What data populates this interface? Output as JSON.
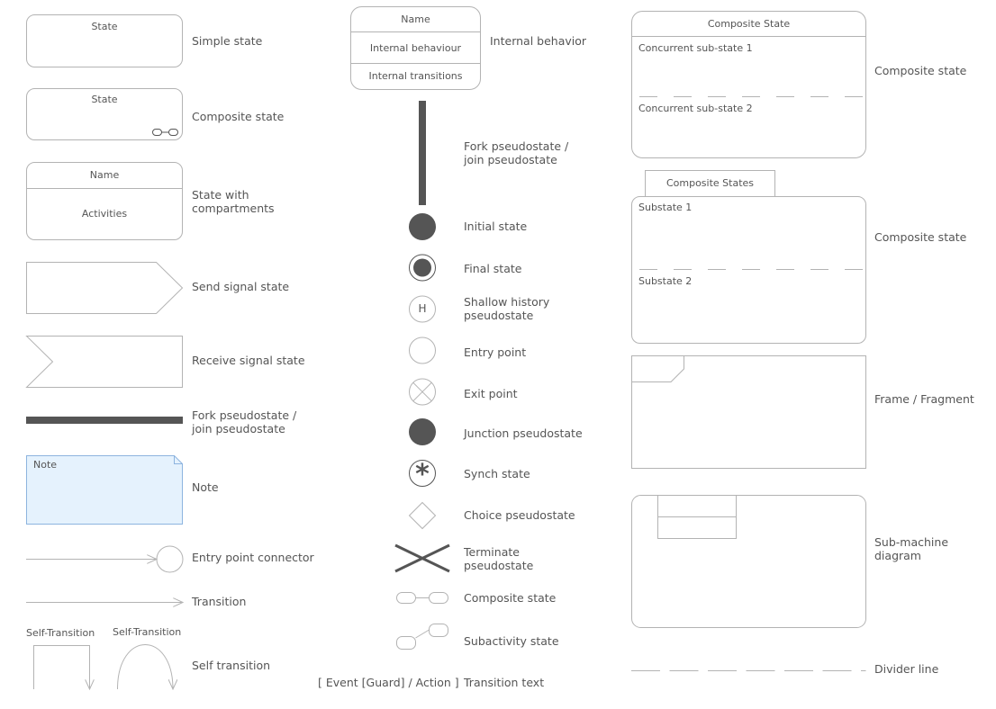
{
  "colors": {
    "stroke": "#b3b3b3",
    "dark": "#555555",
    "note_fill": "#e5f2fd",
    "note_stroke": "#8db4df",
    "text": "#555555"
  },
  "left": {
    "simple_state": {
      "name": "State",
      "label": "Simple state"
    },
    "composite_state": {
      "name": "State",
      "label": "Composite state",
      "icon": "composite-link-icon"
    },
    "state_compartments": {
      "name": "Name",
      "body": "Activities",
      "label": "State with\ncompartments"
    },
    "send_signal": {
      "label": "Send signal state"
    },
    "receive_signal": {
      "label": "Receive signal state"
    },
    "fork_horizontal": {
      "label": "Fork pseudostate /\njoin pseudostate"
    },
    "note": {
      "text": "Note",
      "label": "Note"
    },
    "entry_connector": {
      "label": "Entry point connector"
    },
    "transition": {
      "label": "Transition"
    },
    "self_transition": {
      "caption_1": "Self-Transition",
      "caption_2": "Self-Transition",
      "label": "Self transition"
    }
  },
  "middle": {
    "internal_behavior": {
      "name": "Name",
      "row1": "Internal behaviour",
      "row2": "Internal transitions",
      "label": "Internal behavior"
    },
    "fork_vertical": {
      "label": "Fork pseudostate /\njoin pseudostate"
    },
    "initial_state": {
      "label": "Initial state"
    },
    "final_state": {
      "label": "Final state"
    },
    "shallow_history": {
      "glyph": "H",
      "label": "Shallow history\npseudostate"
    },
    "entry_point": {
      "label": "Entry point"
    },
    "exit_point": {
      "label": "Exit point"
    },
    "junction": {
      "label": "Junction pseudostate"
    },
    "synch_state": {
      "glyph": "*",
      "label": "Synch state"
    },
    "choice": {
      "label": "Choice pseudostate"
    },
    "terminate": {
      "label": "Terminate\npseudostate"
    },
    "composite_icon": {
      "label": "Composite state"
    },
    "subactivity": {
      "label": "Subactivity state"
    },
    "transition_text": {
      "text": "[ Event [Guard] / Action ]",
      "label": "Transition text"
    }
  },
  "right": {
    "composite_concurrent": {
      "title": "Composite State",
      "sub1": "Concurrent sub-state 1",
      "sub2": "Concurrent sub-state 2",
      "label": "Composite state"
    },
    "composite_tab": {
      "tab": "Composite States",
      "sub1": "Substate 1",
      "sub2": "Substate 2",
      "label": "Composite state"
    },
    "frame": {
      "label": "Frame / Fragment"
    },
    "submachine": {
      "label": "Sub-machine\ndiagram"
    },
    "divider": {
      "label": "Divider line"
    }
  }
}
